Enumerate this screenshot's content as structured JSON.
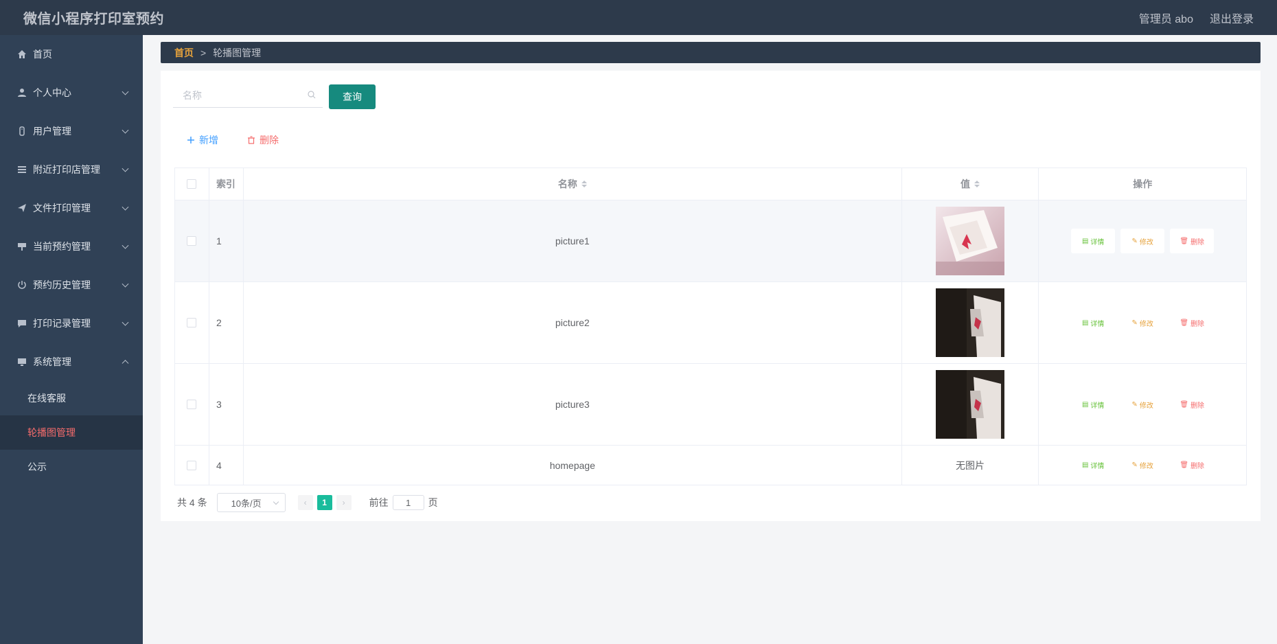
{
  "header": {
    "title": "微信小程序打印室预约",
    "admin_label": "管理员 abo",
    "logout_label": "退出登录"
  },
  "sidebar": {
    "items": [
      {
        "label": "首页",
        "icon": "home-icon",
        "expandable": false
      },
      {
        "label": "个人中心",
        "icon": "user-icon",
        "expandable": true
      },
      {
        "label": "用户管理",
        "icon": "users-icon",
        "expandable": true
      },
      {
        "label": "附近打印店管理",
        "icon": "list-icon",
        "expandable": true
      },
      {
        "label": "文件打印管理",
        "icon": "send-icon",
        "expandable": true
      },
      {
        "label": "当前预约管理",
        "icon": "pin-icon",
        "expandable": true
      },
      {
        "label": "预约历史管理",
        "icon": "power-icon",
        "expandable": true
      },
      {
        "label": "打印记录管理",
        "icon": "chat-icon",
        "expandable": true
      },
      {
        "label": "系统管理",
        "icon": "monitor-icon",
        "expandable": true,
        "expanded": true
      }
    ],
    "sub_items": [
      {
        "label": "在线客服",
        "active": false
      },
      {
        "label": "轮播图管理",
        "active": true
      },
      {
        "label": "公示",
        "active": false
      }
    ]
  },
  "breadcrumb": {
    "home": "首页",
    "separator": ">",
    "current": "轮播图管理"
  },
  "search": {
    "placeholder": "名称",
    "query_label": "查询"
  },
  "actions": {
    "add_label": "新增",
    "delete_label": "删除"
  },
  "table": {
    "headers": {
      "index": "索引",
      "name": "名称",
      "value": "值",
      "ops": "操作"
    },
    "rows": [
      {
        "index": "1",
        "name": "picture1",
        "value": "",
        "image": "book-pink"
      },
      {
        "index": "2",
        "name": "picture2",
        "value": "",
        "image": "book-dark"
      },
      {
        "index": "3",
        "name": "picture3",
        "value": "",
        "image": "book-dark"
      },
      {
        "index": "4",
        "name": "homepage",
        "value": "无图片",
        "image": null
      }
    ],
    "op_labels": {
      "detail": "详情",
      "edit": "修改",
      "remove": "删除"
    }
  },
  "pagination": {
    "total": "共 4 条",
    "page_size": "10条/页",
    "current_page": "1",
    "goto_label": "前往",
    "goto_value": "1",
    "page_suffix": "页"
  },
  "colors": {
    "accent": "#168a7e",
    "header_bg": "#2d3a4b",
    "sidebar_bg": "#304156",
    "active_menu": "#f56c6c"
  }
}
